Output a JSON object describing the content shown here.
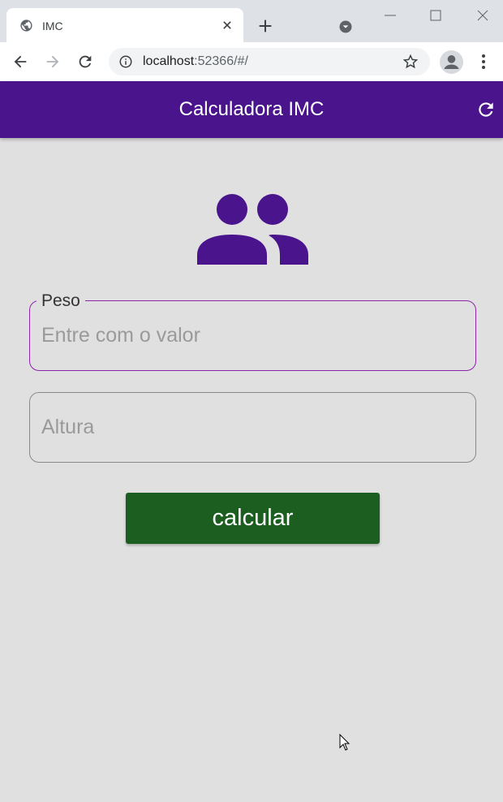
{
  "browser": {
    "tab_title": "IMC",
    "url_host": "localhost",
    "url_rest": ":52366/#/"
  },
  "app": {
    "title": "Calculadora IMC",
    "header_color": "#4a148c",
    "accent_color": "#8e24aa",
    "button_color": "#1b5e20"
  },
  "form": {
    "peso": {
      "label": "Peso",
      "placeholder": "Entre com o valor",
      "value": ""
    },
    "altura": {
      "label": "Altura",
      "placeholder": "Altura",
      "value": ""
    },
    "button_label": "calcular"
  },
  "icons": {
    "header_action": "refresh-icon",
    "hero": "people-icon"
  }
}
